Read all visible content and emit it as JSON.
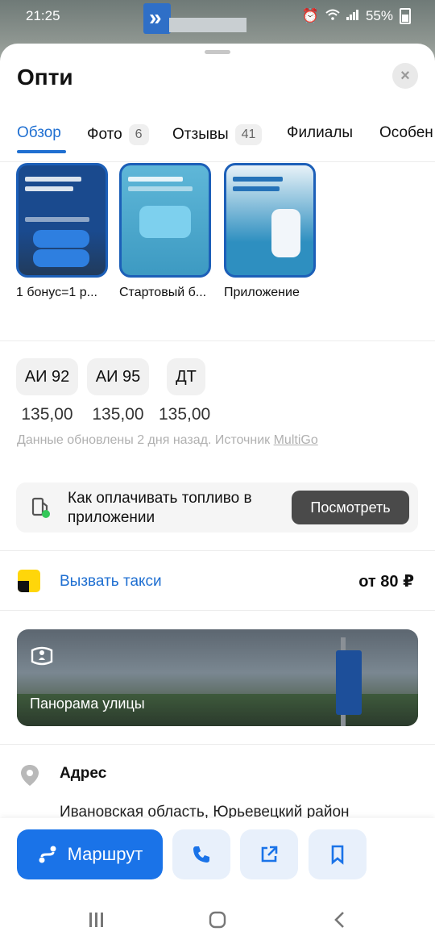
{
  "status_bar": {
    "time": "21:25",
    "battery": "55%"
  },
  "header": {
    "title": "Опти",
    "close_label": "×"
  },
  "tabs": [
    {
      "label": "Обзор",
      "count": ""
    },
    {
      "label": "Фото",
      "count": "6"
    },
    {
      "label": "Отзывы",
      "count": "41"
    },
    {
      "label": "Филиалы",
      "count": ""
    },
    {
      "label": "Особен",
      "count": ""
    }
  ],
  "promos": [
    {
      "caption": "1 бонус=1 р..."
    },
    {
      "caption": "Стартовый б..."
    },
    {
      "caption": "Приложение"
    }
  ],
  "fuel": {
    "items": [
      {
        "name": "АИ 92",
        "price": "135,00"
      },
      {
        "name": "АИ 95",
        "price": "135,00"
      },
      {
        "name": "ДТ",
        "price": "135,00"
      }
    ],
    "updated_text": "Данные обновлены 2 дня назад. Источник ",
    "source_link": "MultiGo"
  },
  "payment": {
    "text": "Как оплачивать топливо в приложении",
    "button": "Посмотреть"
  },
  "taxi": {
    "label": "Вызвать такси",
    "price": "от 80 ₽"
  },
  "panorama": {
    "label": "Панорама улицы"
  },
  "address": {
    "label": "Адрес",
    "text": "Ивановская область, Юрьевецкий район"
  },
  "actions": {
    "route": "Маршрут"
  },
  "colors": {
    "accent": "#1a73e8",
    "link": "#1f6fd1"
  }
}
